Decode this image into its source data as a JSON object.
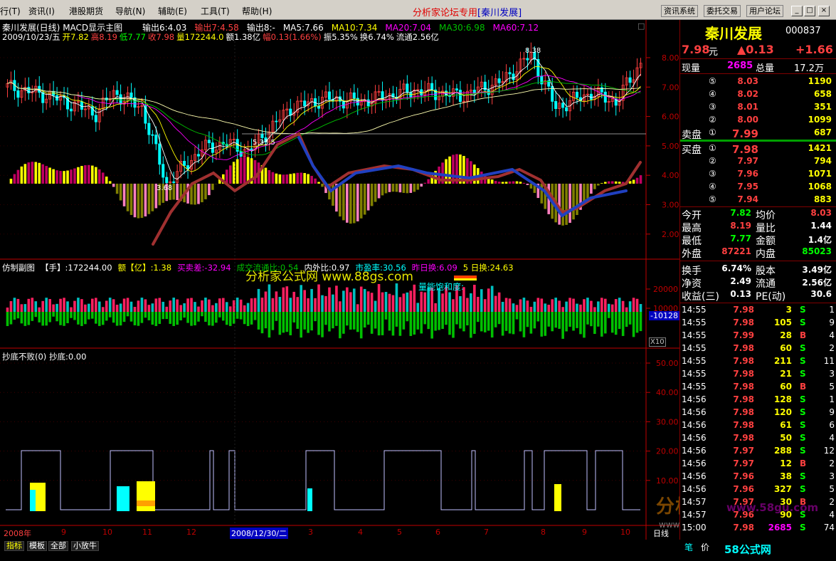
{
  "menu": {
    "items": [
      "行(T)",
      "资讯(I)",
      "港股期货",
      "导航(N)",
      "辅助(E)",
      "工具(T)",
      "帮助(H)"
    ]
  },
  "title": {
    "prefix": "分析家论坛专用",
    "stock": "[秦川发展]"
  },
  "toolbar": {
    "buttons": [
      "资讯系统",
      "委托交易",
      "用户论坛"
    ]
  },
  "window_controls": [
    "_",
    "□",
    "×"
  ],
  "main_chart": {
    "header": "秦川发展(日线)",
    "indicator": "MACD显示主图",
    "outputs": [
      {
        "text": "输出6:4.03",
        "color": "#ffffff"
      },
      {
        "text": "输出7:4.58",
        "color": "#ff4040"
      },
      {
        "text": "输出8:-",
        "color": "#ffffff"
      },
      {
        "text": "MA5:7.66",
        "color": "#ffffff"
      },
      {
        "text": "MA10:7.34",
        "color": "#ffff00"
      },
      {
        "text": "MA20:7.04",
        "color": "#ff00ff"
      },
      {
        "text": "MA30:6.98",
        "color": "#00c000"
      },
      {
        "text": "MA60:7.12",
        "color": "#ff00ff"
      }
    ],
    "date_line": [
      {
        "text": "2009/10/23/五",
        "color": "#ffffff"
      },
      {
        "text": "开7.82",
        "color": "#ffff00"
      },
      {
        "text": "高8.19",
        "color": "#ff4040"
      },
      {
        "text": "低7.77",
        "color": "#00ff00"
      },
      {
        "text": "收7.98",
        "color": "#ff4040"
      },
      {
        "text": "量172244.0",
        "color": "#ffff00"
      },
      {
        "text": "额1.38亿",
        "color": "#ffffff"
      },
      {
        "text": "幅0.13(1.66%)",
        "color": "#ff4040"
      },
      {
        "text": "振5.35%",
        "color": "#ffffff"
      },
      {
        "text": "换6.74%",
        "color": "#ffffff"
      },
      {
        "text": "流通2.56亿",
        "color": "#ffffff"
      }
    ],
    "annotations": {
      "high": "8.38",
      "low": "3.68",
      "mid": "5.33.5"
    },
    "y_ticks": [
      "8.00",
      "7.00",
      "6.00",
      "5.00",
      "4.00",
      "3.00",
      "2.00"
    ]
  },
  "sub_chart": {
    "items": [
      {
        "text": "仿制副图",
        "color": "#ffffff"
      },
      {
        "text": "【手】:172244.00",
        "color": "#ffffff"
      },
      {
        "text": "额【亿】:1.38",
        "color": "#ffff00"
      },
      {
        "text": "买卖差:-32.94",
        "color": "#ff00ff"
      },
      {
        "text": "成交流通比:0.54",
        "color": "#00c000"
      },
      {
        "text": "内外比:0.97",
        "color": "#ffffff"
      },
      {
        "text": "市盈率:30.56",
        "color": "#00ffff"
      },
      {
        "text": "昨日换:6.09",
        "color": "#ff00ff"
      },
      {
        "text": "5 日换:24.63",
        "color": "#ffff00"
      }
    ],
    "watermark": "分析家公式网 www.88gs.com",
    "overlay": "量能饱和度:",
    "y_ticks": [
      "20000",
      "10000"
    ],
    "readout": "-10128",
    "multiplier": "X10"
  },
  "third_chart": {
    "header": "抄底不败(0)",
    "value": "抄底:0.00",
    "y_ticks": [
      "50.00",
      "40.00",
      "30.00",
      "20.00",
      "10.00"
    ]
  },
  "x_axis": {
    "labels": [
      "2008年",
      "9",
      "10",
      "11",
      "12",
      "3",
      "4",
      "5",
      "6",
      "7",
      "8",
      "9",
      "10"
    ],
    "cursor_date": "2008/12/30/二",
    "period": "日线"
  },
  "bottom_tabs": [
    "指标",
    "模板",
    "全部",
    "小放牛"
  ],
  "quote": {
    "name": "秦川发展",
    "code": "000837",
    "price": "7.98",
    "price_unit": "元",
    "change": "▲0.13",
    "change_pct": "+1.66",
    "now_vol_label": "现量",
    "now_vol": "2685",
    "total_vol_label": "总量",
    "total_vol": "17.2万",
    "sell": [
      {
        "level": "⑤",
        "price": "8.03",
        "vol": "1190"
      },
      {
        "level": "④",
        "price": "8.02",
        "vol": "658"
      },
      {
        "level": "③",
        "price": "8.01",
        "vol": "351"
      },
      {
        "level": "②",
        "price": "8.00",
        "vol": "1099"
      },
      {
        "level": "①",
        "price": "7.99",
        "vol": "687"
      }
    ],
    "sell_label": "卖盘",
    "buy_label": "买盘",
    "buy": [
      {
        "level": "①",
        "price": "7.98",
        "vol": "1421"
      },
      {
        "level": "②",
        "price": "7.97",
        "vol": "794"
      },
      {
        "level": "③",
        "price": "7.96",
        "vol": "1071"
      },
      {
        "level": "④",
        "price": "7.95",
        "vol": "1068"
      },
      {
        "level": "⑤",
        "price": "7.94",
        "vol": "883"
      }
    ],
    "stats": [
      {
        "l1": "今开",
        "v1": "7.82",
        "c1": "#00ff00",
        "l2": "均价",
        "v2": "8.03",
        "c2": "#ff4040"
      },
      {
        "l1": "最高",
        "v1": "8.19",
        "c1": "#ff4040",
        "l2": "量比",
        "v2": "1.44",
        "c2": "#ffffff"
      },
      {
        "l1": "最低",
        "v1": "7.77",
        "c1": "#00ff00",
        "l2": "金额",
        "v2": "1.4亿",
        "c2": "#ffffff"
      },
      {
        "l1": "外盘",
        "v1": "87221",
        "c1": "#ff4040",
        "l2": "内盘",
        "v2": "85023",
        "c2": "#00ff00"
      }
    ],
    "stats2": [
      {
        "l1": "换手",
        "v1": "6.74%",
        "l2": "股本",
        "v2": "3.49亿"
      },
      {
        "l1": "净资",
        "v1": "2.49",
        "l2": "流通",
        "v2": "2.56亿"
      },
      {
        "l1": "收益(三)",
        "v1": "0.13",
        "l2": "PE(动)",
        "v2": "30.6"
      }
    ],
    "ticks": [
      {
        "t": "14:55",
        "p": "7.98",
        "v": "3",
        "s": "S",
        "n": "1"
      },
      {
        "t": "14:55",
        "p": "7.98",
        "v": "105",
        "s": "S",
        "n": "9"
      },
      {
        "t": "14:55",
        "p": "7.99",
        "v": "28",
        "s": "B",
        "n": "4"
      },
      {
        "t": "14:55",
        "p": "7.98",
        "v": "60",
        "s": "S",
        "n": "2"
      },
      {
        "t": "14:55",
        "p": "7.98",
        "v": "211",
        "s": "S",
        "n": "11"
      },
      {
        "t": "14:55",
        "p": "7.98",
        "v": "21",
        "s": "S",
        "n": "3"
      },
      {
        "t": "14:55",
        "p": "7.98",
        "v": "60",
        "s": "B",
        "n": "5"
      },
      {
        "t": "14:56",
        "p": "7.98",
        "v": "128",
        "s": "S",
        "n": "1"
      },
      {
        "t": "14:56",
        "p": "7.98",
        "v": "120",
        "s": "S",
        "n": "9"
      },
      {
        "t": "14:56",
        "p": "7.98",
        "v": "61",
        "s": "S",
        "n": "6"
      },
      {
        "t": "14:56",
        "p": "7.98",
        "v": "50",
        "s": "S",
        "n": "4"
      },
      {
        "t": "14:56",
        "p": "7.97",
        "v": "288",
        "s": "S",
        "n": "12"
      },
      {
        "t": "14:56",
        "p": "7.97",
        "v": "12",
        "s": "B",
        "n": "2"
      },
      {
        "t": "14:56",
        "p": "7.96",
        "v": "38",
        "s": "S",
        "n": "3"
      },
      {
        "t": "14:56",
        "p": "7.96",
        "v": "327",
        "s": "S",
        "n": "5"
      },
      {
        "t": "14:57",
        "p": "7.97",
        "v": "30",
        "s": "B",
        "n": "2"
      },
      {
        "t": "14:57",
        "p": "7.96",
        "v": "90",
        "s": "S",
        "n": "4"
      },
      {
        "t": "15:00",
        "p": "7.98",
        "v": "2685",
        "s": "S",
        "n": "74"
      }
    ],
    "bottom_labels": [
      "笔",
      "价"
    ]
  },
  "watermarks": {
    "forum": "分析家论坛",
    "forum_url": "www.88gs.com",
    "site": "58公式网",
    "site_url": "www.58gu.com"
  },
  "colors": {
    "up": "#ff4040",
    "down": "#00ff00",
    "axis": "#c00000",
    "bg": "#000000"
  }
}
